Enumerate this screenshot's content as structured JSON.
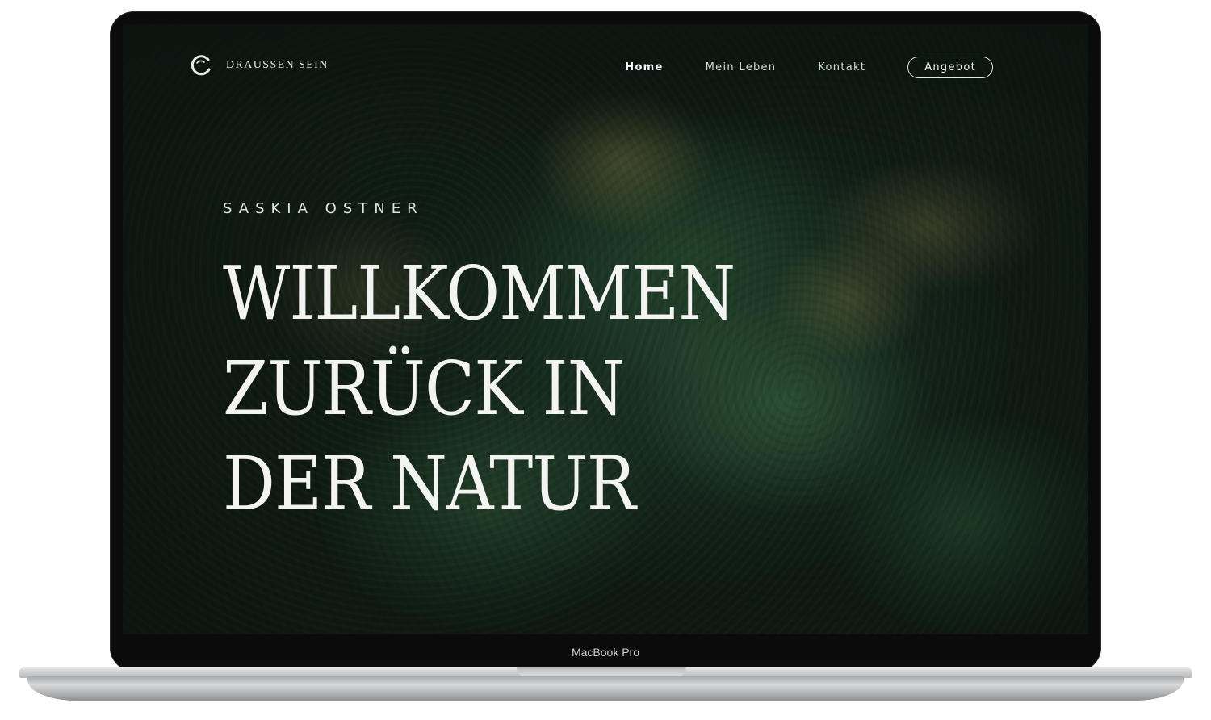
{
  "device": {
    "label": "MacBook Pro"
  },
  "nav": {
    "logo_text": "DRAUSSEN SEIN",
    "links": [
      {
        "label": "Home",
        "active": true
      },
      {
        "label": "Mein Leben",
        "active": false
      },
      {
        "label": "Kontakt",
        "active": false
      }
    ],
    "cta_label": "Angebot"
  },
  "hero": {
    "subtitle": "SASKIA OSTNER",
    "title_lines": [
      "WILLKOMMEN",
      "ZURÜCK IN",
      "DER NATUR"
    ]
  },
  "colors": {
    "forest_dark": "#0f1c14",
    "forest_mid": "#1f3a28",
    "text_light": "#f3f4f2"
  }
}
